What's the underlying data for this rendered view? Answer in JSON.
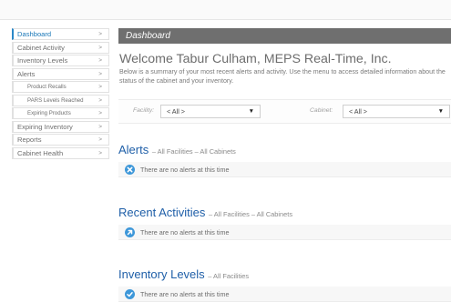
{
  "sidebar": {
    "items": [
      {
        "label": "Dashboard",
        "chevron": ">",
        "active": true
      },
      {
        "label": "Cabinet Activity",
        "chevron": ">"
      },
      {
        "label": "Inventory Levels",
        "chevron": ">"
      },
      {
        "label": "Alerts",
        "chevron": ">"
      },
      {
        "label": "Product Recalls",
        "chevron": ">",
        "sub": true
      },
      {
        "label": "PARS Levels Reached",
        "chevron": ">",
        "sub": true
      },
      {
        "label": "Expiring Products",
        "chevron": ">",
        "sub": true
      },
      {
        "label": "Expiring Inventory",
        "chevron": ">"
      },
      {
        "label": "Reports",
        "chevron": ">"
      },
      {
        "label": "Cabinet Health",
        "chevron": ">"
      }
    ]
  },
  "header": {
    "title": "Dashboard"
  },
  "welcome": {
    "title": "Welcome Tabur Culham, MEPS Real-Time, Inc.",
    "summary": "Below is a summary of your most recent alerts and activity. Use the menu to access detailed information about the status of the cabinet and your inventory."
  },
  "filters": {
    "facility_label": "Facility:",
    "facility_value": "< All >",
    "cabinet_label": "Cabinet:",
    "cabinet_value": "< All >",
    "arrow": "▼"
  },
  "sections": {
    "alerts": {
      "title": "Alerts",
      "subtitle": "– All Facilities  –  All Cabinets",
      "message": "There are no alerts at this time",
      "icon": "close-icon"
    },
    "recent": {
      "title": "Recent Activities",
      "subtitle": "– All Facilities  –  All Cabinets",
      "message": "There are no alerts at this time",
      "icon": "arrow-icon"
    },
    "inventory": {
      "title": "Inventory Levels",
      "subtitle": "– All Facilities",
      "message": "There are no alerts at this time",
      "icon": "check-icon"
    }
  },
  "colors": {
    "accent": "#1f5fa8",
    "header_bg": "#6f6f6f",
    "icon_blue": "#3d97d9"
  }
}
